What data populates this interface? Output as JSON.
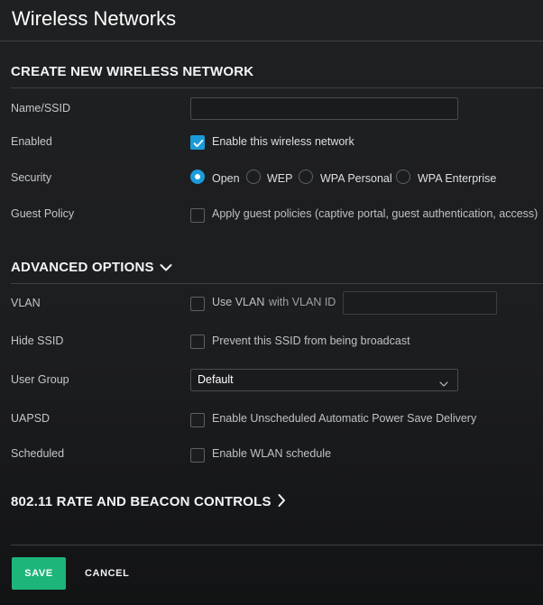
{
  "page": {
    "title": "Wireless Networks"
  },
  "create_section": {
    "heading": "CREATE NEW WIRELESS NETWORK",
    "name_label": "Name/SSID",
    "name_value": "",
    "enabled_label": "Enabled",
    "enabled_option": "Enable this wireless network",
    "enabled_checked": true,
    "security_label": "Security",
    "security_options": [
      "Open",
      "WEP",
      "WPA Personal",
      "WPA Enterprise"
    ],
    "security_selected": "Open",
    "guest_label": "Guest Policy",
    "guest_option": "Apply guest policies (captive portal, guest authentication, access)",
    "guest_checked": false
  },
  "advanced_section": {
    "heading": "ADVANCED OPTIONS",
    "heading_icon": "chevron-down-icon",
    "vlan_label": "VLAN",
    "vlan_option": "Use VLAN",
    "vlan_note": "with VLAN ID",
    "vlan_id_value": "",
    "vlan_checked": false,
    "hide_ssid_label": "Hide SSID",
    "hide_ssid_option": "Prevent this SSID from being broadcast",
    "hide_ssid_checked": false,
    "user_group_label": "User Group",
    "user_group_value": "Default",
    "uapsd_label": "UAPSD",
    "uapsd_option": "Enable Unscheduled Automatic Power Save Delivery",
    "uapsd_checked": false,
    "scheduled_label": "Scheduled",
    "scheduled_option": "Enable WLAN schedule",
    "scheduled_checked": false
  },
  "rate_section": {
    "heading": "802.11 RATE AND BEACON CONTROLS",
    "heading_icon": "chevron-right-icon"
  },
  "footer": {
    "save_label": "SAVE",
    "cancel_label": "CANCEL"
  },
  "colors": {
    "background": "#1e1f21",
    "accent_blue": "#1c9bd9",
    "save_green": "#1db57a",
    "divider": "#3d3f42"
  }
}
